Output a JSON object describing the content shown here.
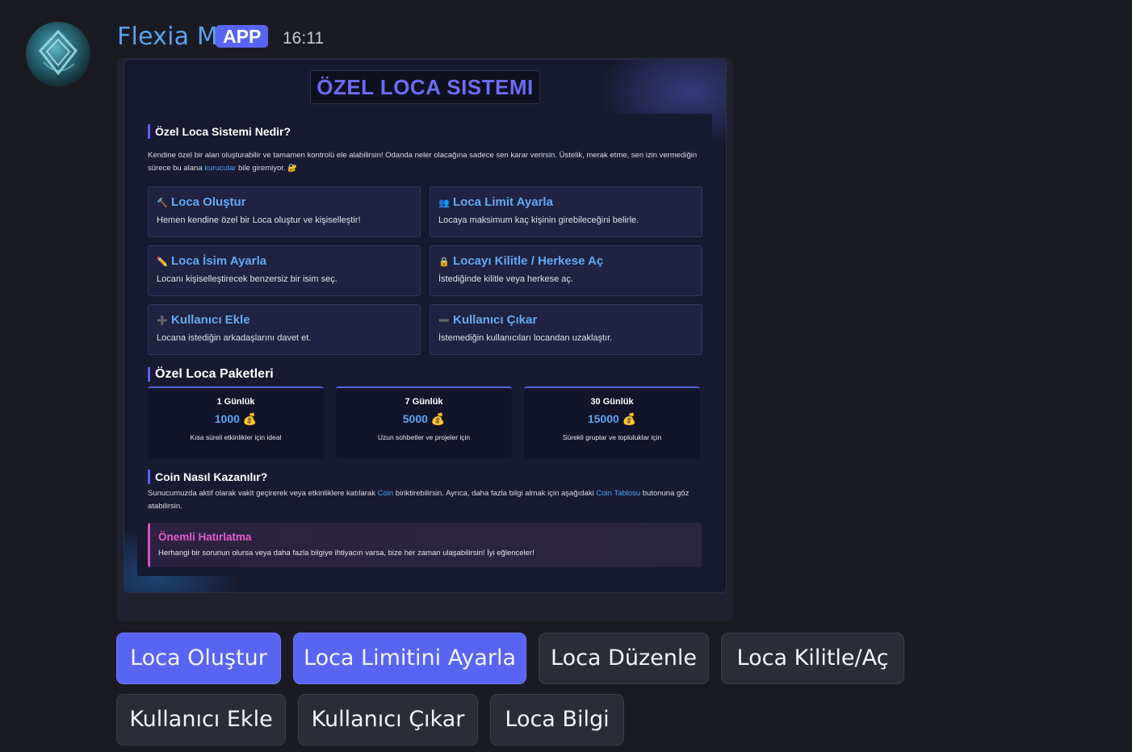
{
  "message": {
    "username": "Flexia M",
    "badge": "APP",
    "timestamp": "16:11",
    "avatar_icon": "diamond-logo-icon"
  },
  "embed": {
    "title": "ÖZEL LOCA SISTEMI",
    "what_is": {
      "heading": "Özel Loca Sistemi Nedir?",
      "text_before_link": "Kendine özel bir alan oluşturabilir ve tamamen kontrolü ele alabilirsin! Odanda neler olacağına sadece sen karar verirsin. Üstelik, merak etme, sen izin vermediğin sürece bu alana ",
      "link": "kurucular",
      "text_after_link": " bile giremiyor. 🔐"
    },
    "features": [
      {
        "icon": "🔨",
        "title": "Loca Oluştur",
        "desc": "Hemen kendine özel bir Loca oluştur ve kişiselleştir!"
      },
      {
        "icon": "👥",
        "title": "Loca Limit Ayarla",
        "desc": "Locaya maksimum kaç kişinin girebileceğini belirle."
      },
      {
        "icon": "✏️",
        "title": "Loca İsim Ayarla",
        "desc": "Locanı kişiselleştirecek benzersiz bir isim seç."
      },
      {
        "icon": "🔒",
        "title": "Locayı Kilitle / Herkese Aç",
        "desc": "İstediğinde kilitle veya herkese aç."
      },
      {
        "icon": "➕",
        "title": "Kullanıcı Ekle",
        "desc": "Locana istediğin arkadaşlarını davet et."
      },
      {
        "icon": "➖",
        "title": "Kullanıcı Çıkar",
        "desc": "İstemediğin kullanıcıları locandan uzaklaştır."
      }
    ],
    "packages_heading": "Özel Loca Paketleri",
    "packages": [
      {
        "name": "1 Günlük",
        "price": "1000 💰",
        "desc": "Kısa süreli etkinlikler için ideal"
      },
      {
        "name": "7 Günlük",
        "price": "5000 💰",
        "desc": "Uzun sohbetler ve projeler için"
      },
      {
        "name": "30 Günlük",
        "price": "15000 💰",
        "desc": "Sürekli gruplar ve topluluklar için"
      }
    ],
    "coin": {
      "heading": "Coin Nasıl Kazanılır?",
      "t1": "Sunucumuzda aktif olarak vakit geçirerek veya etkinliklere katılarak ",
      "link1": "Coin",
      "t2": " biriktirebilirsin. Ayrıca, daha fazla bilgi almak için aşağıdaki ",
      "link2": "Coin Tablosu",
      "t3": " butonuna göz atabilirsin."
    },
    "reminder": {
      "title": "Önemli Hatırlatma",
      "text": "Herhangi bir sorunun olursa veya daha fazla bilgiye ihtiyacın varsa, bize her zaman ulaşabilirsin! İyi eğlenceler!"
    }
  },
  "buttons": [
    {
      "label": "Loca Oluştur",
      "style": "primary"
    },
    {
      "label": "Loca Limitini Ayarla",
      "style": "primary"
    },
    {
      "label": "Loca Düzenle",
      "style": "secondary"
    },
    {
      "label": "Loca Kilitle/Aç",
      "style": "secondary"
    },
    {
      "label": "Kullanıcı Ekle",
      "style": "secondary"
    },
    {
      "label": "Kullanıcı Çıkar",
      "style": "secondary"
    },
    {
      "label": "Loca Bilgi",
      "style": "secondary"
    }
  ],
  "colors": {
    "background": "#1a1b22",
    "username": "#5aa2f0",
    "primary_button": "#5865f2",
    "secondary_button": "#2b2d36",
    "title_accent": "#6d6cf3",
    "feature_title": "#62aaf2",
    "reminder_accent": "#e45bc9"
  }
}
